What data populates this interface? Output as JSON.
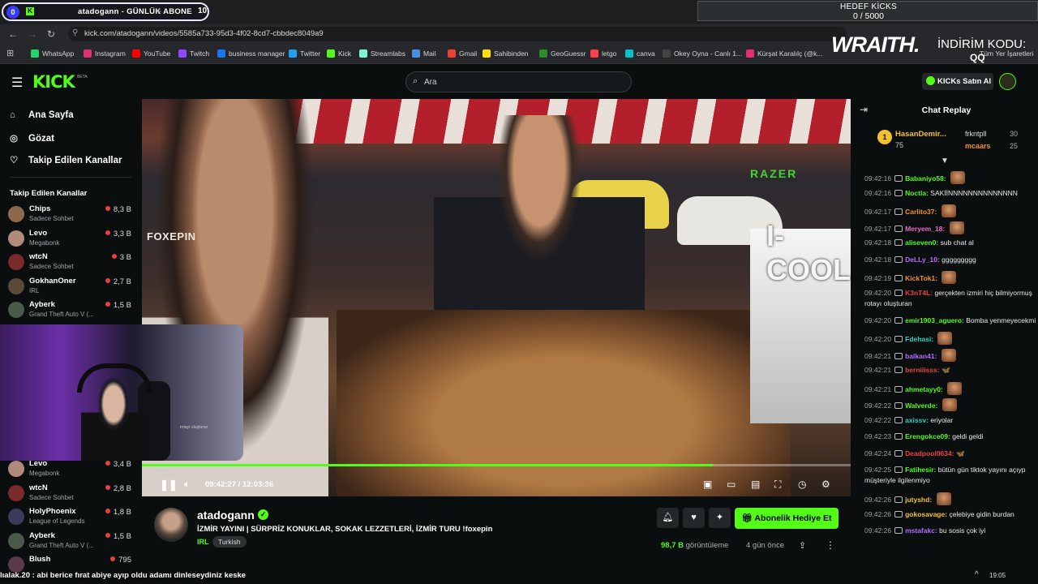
{
  "browser": {
    "tab_group_number": "0",
    "tab_title": "atadogann - GÜNLÜK ABONE",
    "tab_count": "10",
    "abone_label": "GÜNLÜK ABONE",
    "url": "kick.com/atadogann/videos/5585a733-95d3-4f02-8cd7-cbbdec8049a9",
    "bookmarks": [
      "WhatsApp",
      "Instagram",
      "YouTube",
      "Twitch",
      "business manager",
      "Twitter",
      "Kick",
      "Streamlabs",
      "Mail",
      "Gmail",
      "Sahibinden",
      "GeoGuessr",
      "letgo",
      "canva",
      "Okey Oyna - Canlı 1...",
      "Kürşat Karalılç (@k..."
    ],
    "bookmark_colors": [
      "#25d366",
      "#e1306c",
      "#ff0000",
      "#9146ff",
      "#1877f2",
      "#1da1f2",
      "#53fc18",
      "#80f5d2",
      "#4a90e2",
      "#ea4335",
      "#ffe000",
      "#2c8c2c",
      "#ff3e4d",
      "#00c4cc",
      "#444",
      "#e1306c"
    ],
    "right_bookmarks": "Tüm Yer İşaretleri"
  },
  "goal": {
    "title": "HEDEF KİCKS",
    "count": "0 / 5000"
  },
  "promo": {
    "brand": "WRAITH.",
    "label": "İNDİRİM KODU:",
    "code": "QQ"
  },
  "header": {
    "logo": "KICK",
    "beta": "BETA",
    "search_placeholder": "Ara",
    "buy_label": "KICKs Satın Al"
  },
  "sidebar": {
    "nav": [
      {
        "label": "Ana Sayfa",
        "icon": "home-icon"
      },
      {
        "label": "Gözat",
        "icon": "compass-icon"
      },
      {
        "label": "Takip Edilen Kanallar",
        "icon": "heart-icon"
      }
    ],
    "followed_heading": "Takip Edilen Kanallar",
    "channels_top": [
      {
        "name": "Chips",
        "category": "Sadece Sohbet",
        "viewers": "8,3 B",
        "color": "#8a6a4a"
      },
      {
        "name": "Levo",
        "category": "Megabonk",
        "viewers": "3,3 B",
        "color": "#b08a7a"
      },
      {
        "name": "wtcN",
        "category": "Sadece Sohbet",
        "viewers": "3 B",
        "color": "#7a2a2a"
      },
      {
        "name": "GokhanOner",
        "category": "IRL",
        "viewers": "2,7 B",
        "color": "#5a4a3a"
      },
      {
        "name": "Ayberk",
        "category": "Grand Theft Auto V (...",
        "viewers": "1,5 B",
        "color": "#4a5a4a"
      }
    ],
    "channels_bottom": [
      {
        "name": "Levo",
        "category": "Megabonk",
        "viewers": "3,4 B",
        "color": "#b08a7a"
      },
      {
        "name": "wtcN",
        "category": "Sadece Sohbet",
        "viewers": "2,8 B",
        "color": "#7a2a2a"
      },
      {
        "name": "HolyPhoenix",
        "category": "League of Legends",
        "viewers": "1,8 B",
        "color": "#3a3a5a"
      },
      {
        "name": "Ayberk",
        "category": "Grand Theft Auto V (...",
        "viewers": "1,5 B",
        "color": "#4a5a4a"
      },
      {
        "name": "Blush",
        "category": "",
        "viewers": "795",
        "color": "#5a3a4a"
      }
    ]
  },
  "player": {
    "time": "09:42:27 / 12:03:36",
    "progress": 0.806,
    "overlay_brand": "FOXEPIN",
    "overlay_razer": "RAZER",
    "overlay_drink": "I-COOL",
    "webcam_chat_snippet": "rotayı oluşturan",
    "webcam_chat_snippet2": "ahmetayy0"
  },
  "overlay_chat": "lıalak.20 : abi berice fırat abiye ayıp oldu adamı dinleseydiniz keske",
  "stream": {
    "channel": "atadogann",
    "title": "İZMİR YAYINI | SÜRPRİZ KONUKLAR, SOKAK LEZZETLERİ, İZMİR TURU !foxepin",
    "category": "IRL",
    "language": "Turkish",
    "gift_label": "Abonelik Hediye Et",
    "views_count": "98,7 B",
    "views_label": "görüntüleme",
    "ago": "4 gün önce"
  },
  "chat": {
    "title": "Chat Replay",
    "leaderboard": {
      "rank": "1",
      "first_name": "HasanDemir...",
      "first_amount": "75",
      "second_name": "frkntpll",
      "second_amount": "30",
      "third_name": "mcaars",
      "third_amount": "25"
    },
    "messages": [
      {
        "ts": "09:42:16",
        "user": "Babaniyo58:",
        "color": "#53fc18",
        "text": "",
        "emote": true
      },
      {
        "ts": "09:42:16",
        "user": "Noctla:",
        "color": "#53fc18",
        "text": "SAKİİNNNNNNNNNNNNNN",
        "emote": false
      },
      {
        "ts": "09:42:17",
        "user": "Carlito37:",
        "color": "#f29130",
        "text": "",
        "emote": true
      },
      {
        "ts": "09:42:17",
        "user": "Meryem_18:",
        "color": "#e66bc8",
        "text": "",
        "emote": true
      },
      {
        "ts": "09:42:18",
        "user": "aliseven0:",
        "color": "#53fc18",
        "text": "sub chat al",
        "emote": false
      },
      {
        "ts": "09:42:18",
        "user": "DeLLy_10:",
        "color": "#b36bff",
        "text": "ggggggggg",
        "emote": false
      },
      {
        "ts": "09:42:19",
        "user": "KickTok1:",
        "color": "#f29130",
        "text": "",
        "emote": true
      },
      {
        "ts": "09:42:20",
        "user": "K3nT4L:",
        "color": "#e84142",
        "text": "gerçekten izmiri hiç bilmiyormuş rotayı oluşturan",
        "emote": false
      },
      {
        "ts": "09:42:20",
        "user": "emir1903_aguero:",
        "color": "#53fc18",
        "text": "Bomba yenmeyecekmi",
        "emote": false
      },
      {
        "ts": "09:42:20",
        "user": "Fdehasi:",
        "color": "#2fd1c4",
        "text": "",
        "emote": true
      },
      {
        "ts": "09:42:21",
        "user": "balkan41:",
        "color": "#b36bff",
        "text": "",
        "emote": true
      },
      {
        "ts": "09:42:21",
        "user": "berniiisss:",
        "color": "#e84142",
        "text": "🦋",
        "emote": false
      },
      {
        "ts": "09:42:21",
        "user": "ahmetayy0:",
        "color": "#53fc18",
        "text": "",
        "emote": true
      },
      {
        "ts": "09:42:22",
        "user": "Walverde:",
        "color": "#53fc18",
        "text": "",
        "emote": true
      },
      {
        "ts": "09:42:22",
        "user": "axissv:",
        "color": "#2fd1c4",
        "text": "eriyolar",
        "emote": false
      },
      {
        "ts": "09:42:23",
        "user": "Erengokce09:",
        "color": "#53fc18",
        "text": "geldi geldi",
        "emote": false
      },
      {
        "ts": "09:42:24",
        "user": "Deadpool0634:",
        "color": "#e84142",
        "text": "🦋",
        "emote": false
      },
      {
        "ts": "09:42:25",
        "user": "Fatihesir:",
        "color": "#53fc18",
        "text": "bütün gün tiktok yayını açıyp müşteriyle ilgilenmiyo",
        "emote": false
      },
      {
        "ts": "09:42:26",
        "user": "jutyshd:",
        "color": "#f2c230",
        "text": "",
        "emote": true
      },
      {
        "ts": "09:42:26",
        "user": "gokosavage:",
        "color": "#f2c230",
        "text": "çelebiye gidin burdan",
        "emote": false
      },
      {
        "ts": "09:42:26",
        "user": "mstafakc:",
        "color": "#b36bff",
        "text": "bu sosis çok iyi",
        "emote": false
      }
    ]
  },
  "taskbar": {
    "time": "19:05"
  }
}
